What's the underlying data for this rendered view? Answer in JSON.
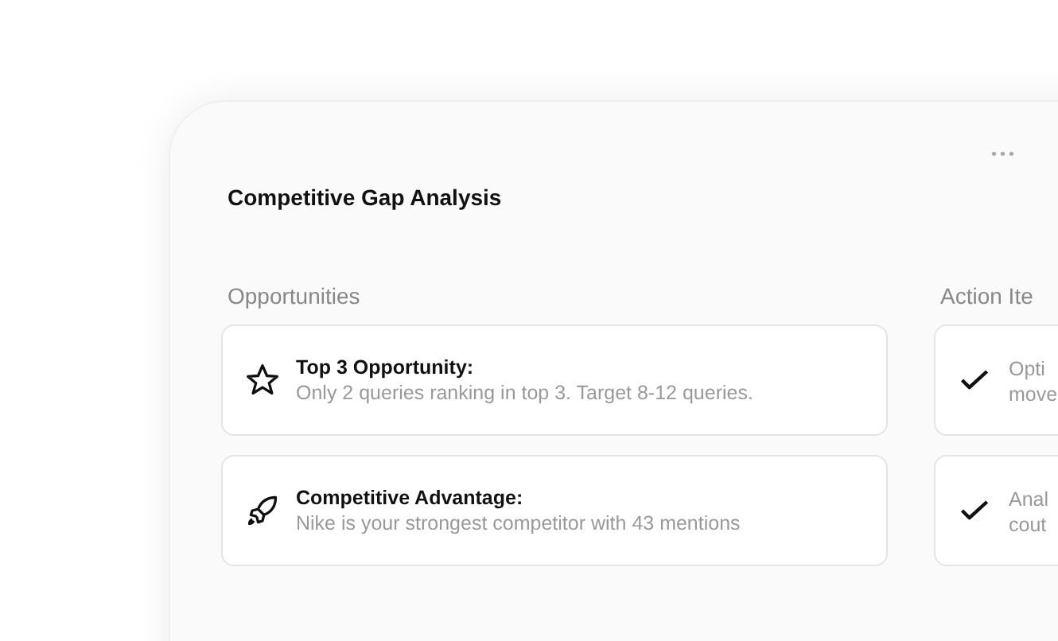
{
  "panel": {
    "title": "Competitive Gap Analysis",
    "menu_icon": "•••"
  },
  "sections": [
    {
      "heading": "Opportunities",
      "items": [
        {
          "kind": "star",
          "title": "Top 3 Opportunity:",
          "text": "Only 2 queries ranking in top 3. Target 8-12 queries."
        },
        {
          "kind": "rocket",
          "title": "Competitive Advantage:",
          "text": "Nike is your strongest competitor with 43 mentions"
        }
      ]
    },
    {
      "heading": "Action Ite",
      "items": [
        {
          "kind": "check",
          "lines": [
            "Opti",
            "move"
          ]
        },
        {
          "kind": "check",
          "lines": [
            "Anal",
            "cout"
          ]
        }
      ]
    }
  ]
}
